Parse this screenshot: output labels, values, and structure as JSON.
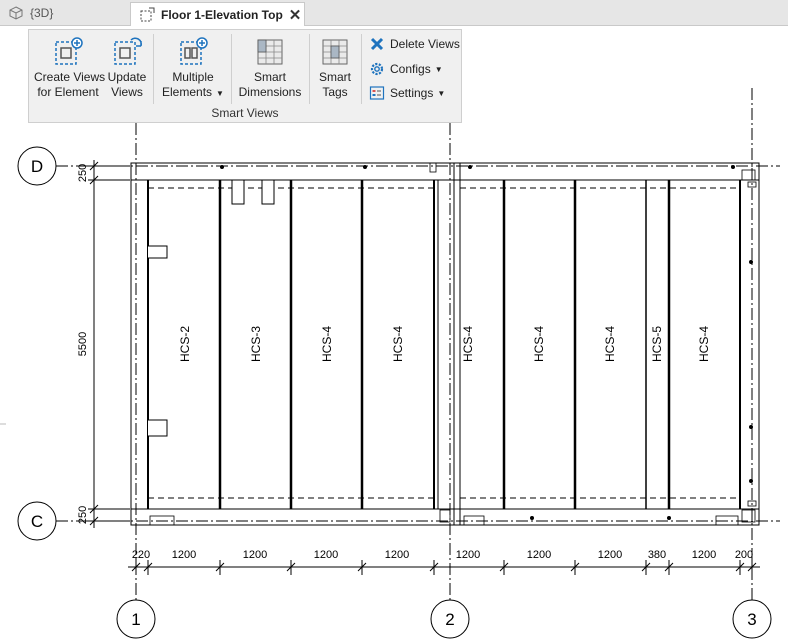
{
  "tabs": [
    {
      "label": "{3D}",
      "icon": "cube-icon",
      "active": false
    },
    {
      "label": "Floor 1-Elevation Top",
      "icon": "view-icon",
      "active": true
    }
  ],
  "ribbon": {
    "create_views": {
      "line1": "Create Views",
      "line2": "for Element"
    },
    "update_views": {
      "line1": "Update",
      "line2": "Views"
    },
    "multiple_elements": {
      "line1": "Multiple",
      "line2": "Elements"
    },
    "smart_dimensions": {
      "line1": "Smart",
      "line2": "Dimensions"
    },
    "smart_tags": {
      "line1": "Smart",
      "line2": "Tags"
    },
    "delete_views": "Delete Views",
    "configs": "Configs",
    "settings": "Settings",
    "group_label": "Smart Views"
  },
  "drawing": {
    "grids": {
      "D": "D",
      "C": "C",
      "g1": "1",
      "g2": "2",
      "g3": "3"
    },
    "vertical_dims": [
      "250",
      "5500",
      "250"
    ],
    "horizontal_dims": [
      "220",
      "1200",
      "1200",
      "1200",
      "1200",
      "1200",
      "1200",
      "1200",
      "380",
      "1200",
      "200"
    ],
    "slab_tags": [
      "HCS-2",
      "HCS-3",
      "HCS-4",
      "HCS-4",
      "HCS-4",
      "HCS-4",
      "HCS-4",
      "HCS-5",
      "HCS-4"
    ]
  },
  "colors": {
    "accent": "#1e73be",
    "tabbar": "#e6e6e6",
    "ribbon": "#f0f0f0"
  }
}
